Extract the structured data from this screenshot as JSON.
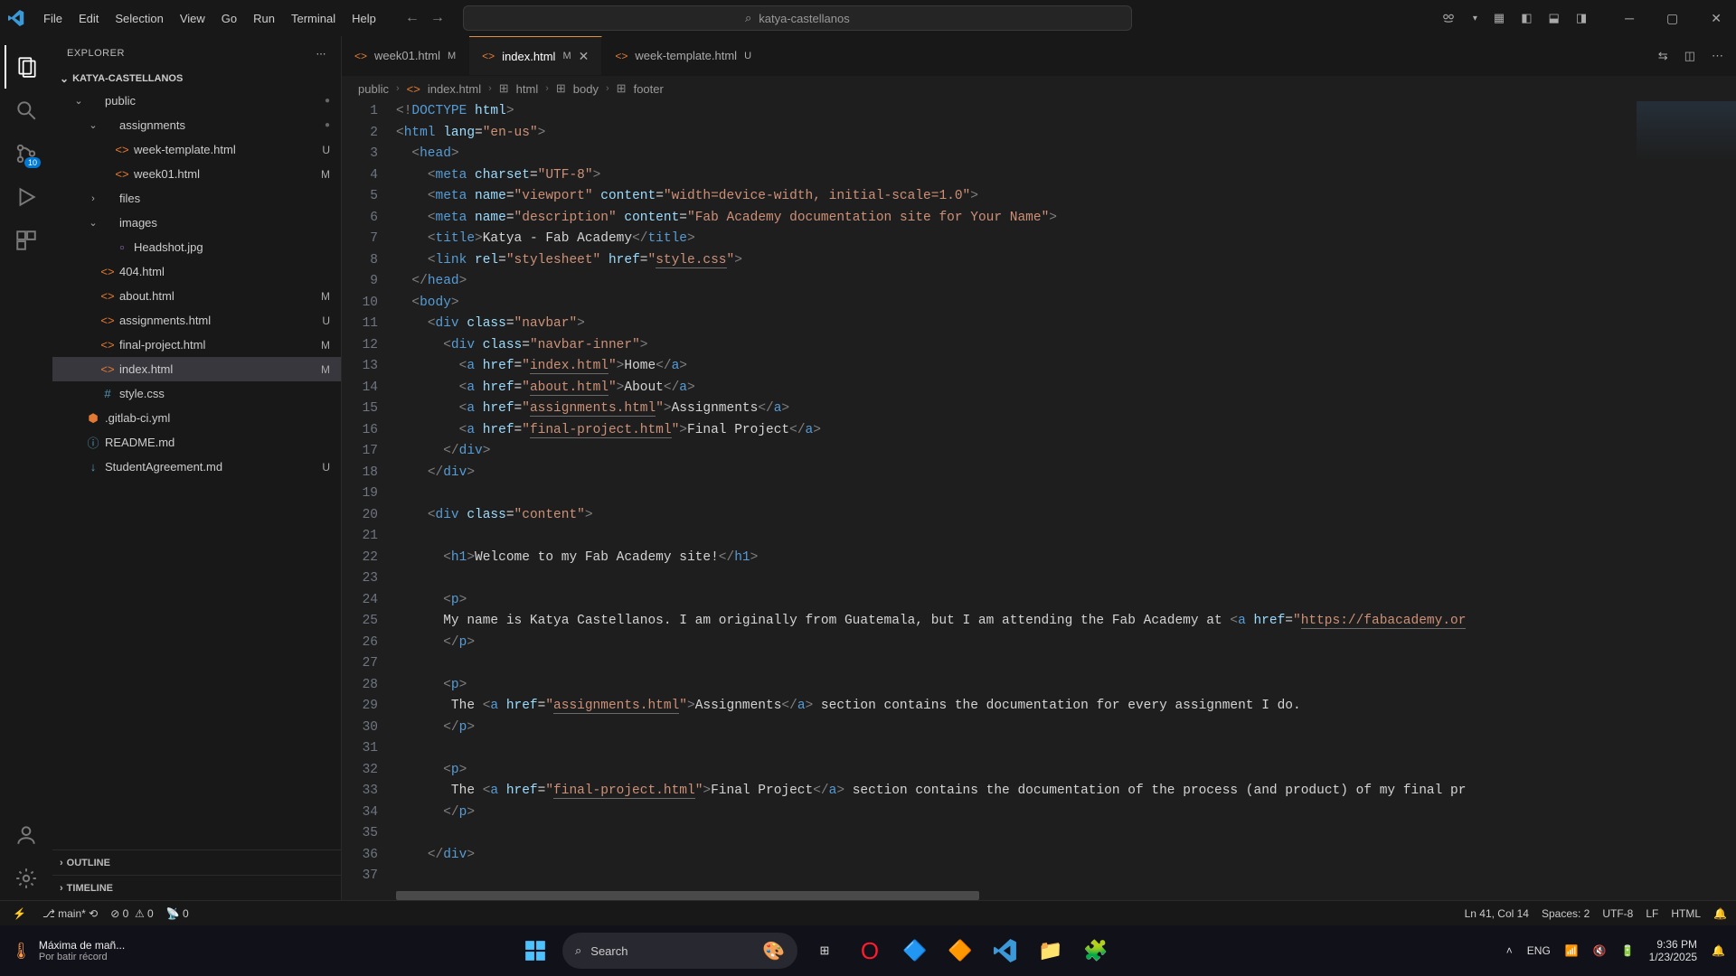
{
  "menu": [
    "File",
    "Edit",
    "Selection",
    "View",
    "Go",
    "Run",
    "Terminal",
    "Help"
  ],
  "search_placeholder": "katya-castellanos",
  "explorer_label": "EXPLORER",
  "project_name": "KATYA-CASTELLANOS",
  "tree": [
    {
      "d": 1,
      "type": "fo",
      "label": "public",
      "dot": true
    },
    {
      "d": 2,
      "type": "fo",
      "label": "assignments",
      "dot": true
    },
    {
      "d": 3,
      "type": "f",
      "icon": "<>",
      "ic": "ic-orange",
      "label": "week-template.html",
      "badge": "U"
    },
    {
      "d": 3,
      "type": "f",
      "icon": "<>",
      "ic": "ic-orange",
      "label": "week01.html",
      "badge": "M"
    },
    {
      "d": 2,
      "type": "fc",
      "label": "files"
    },
    {
      "d": 2,
      "type": "fo",
      "label": "images"
    },
    {
      "d": 3,
      "type": "f",
      "icon": "▫",
      "ic": "ic-purple",
      "label": "Headshot.jpg"
    },
    {
      "d": 2,
      "type": "f",
      "icon": "<>",
      "ic": "ic-orange",
      "label": "404.html"
    },
    {
      "d": 2,
      "type": "f",
      "icon": "<>",
      "ic": "ic-orange",
      "label": "about.html",
      "badge": "M"
    },
    {
      "d": 2,
      "type": "f",
      "icon": "<>",
      "ic": "ic-orange",
      "label": "assignments.html",
      "badge": "U"
    },
    {
      "d": 2,
      "type": "f",
      "icon": "<>",
      "ic": "ic-orange",
      "label": "final-project.html",
      "badge": "M"
    },
    {
      "d": 2,
      "type": "f",
      "icon": "<>",
      "ic": "ic-orange",
      "label": "index.html",
      "badge": "M",
      "sel": true
    },
    {
      "d": 2,
      "type": "f",
      "icon": "#",
      "ic": "ic-blue",
      "label": "style.css"
    },
    {
      "d": 1,
      "type": "f",
      "icon": "⬢",
      "ic": "ic-orange",
      "label": ".gitlab-ci.yml"
    },
    {
      "d": 1,
      "type": "f",
      "icon": "ⓘ",
      "ic": "ic-blue",
      "label": "README.md"
    },
    {
      "d": 1,
      "type": "f",
      "icon": "↓",
      "ic": "ic-blue",
      "label": "StudentAgreement.md",
      "badge": "U"
    }
  ],
  "outline_label": "OUTLINE",
  "timeline_label": "TIMELINE",
  "tabs": [
    {
      "icon": "<>",
      "label": "week01.html",
      "mod": "M",
      "active": false
    },
    {
      "icon": "<>",
      "label": "index.html",
      "mod": "M",
      "active": true,
      "close": true
    },
    {
      "icon": "<>",
      "label": "week-template.html",
      "mod": "U",
      "active": false
    }
  ],
  "breadcrumb": [
    "public",
    "index.html",
    "html",
    "body",
    "footer"
  ],
  "code_lines": [
    [
      {
        "c": "t-gray",
        "t": "<!"
      },
      {
        "c": "t-blue",
        "t": "DOCTYPE"
      },
      {
        "c": "t-txt",
        "t": " "
      },
      {
        "c": "t-lblue",
        "t": "html"
      },
      {
        "c": "t-gray",
        "t": ">"
      }
    ],
    [
      {
        "c": "t-gray",
        "t": "<"
      },
      {
        "c": "t-blue",
        "t": "html"
      },
      {
        "c": "t-txt",
        "t": " "
      },
      {
        "c": "t-lblue",
        "t": "lang"
      },
      {
        "c": "t-txt",
        "t": "="
      },
      {
        "c": "t-str",
        "t": "\"en-us\""
      },
      {
        "c": "t-gray",
        "t": ">"
      }
    ],
    [
      {
        "c": "t-txt",
        "t": "  "
      },
      {
        "c": "t-gray",
        "t": "<"
      },
      {
        "c": "t-blue",
        "t": "head"
      },
      {
        "c": "t-gray",
        "t": ">"
      }
    ],
    [
      {
        "c": "t-txt",
        "t": "    "
      },
      {
        "c": "t-gray",
        "t": "<"
      },
      {
        "c": "t-blue",
        "t": "meta"
      },
      {
        "c": "t-txt",
        "t": " "
      },
      {
        "c": "t-lblue",
        "t": "charset"
      },
      {
        "c": "t-txt",
        "t": "="
      },
      {
        "c": "t-str",
        "t": "\"UTF-8\""
      },
      {
        "c": "t-gray",
        "t": ">"
      }
    ],
    [
      {
        "c": "t-txt",
        "t": "    "
      },
      {
        "c": "t-gray",
        "t": "<"
      },
      {
        "c": "t-blue",
        "t": "meta"
      },
      {
        "c": "t-txt",
        "t": " "
      },
      {
        "c": "t-lblue",
        "t": "name"
      },
      {
        "c": "t-txt",
        "t": "="
      },
      {
        "c": "t-str",
        "t": "\"viewport\""
      },
      {
        "c": "t-txt",
        "t": " "
      },
      {
        "c": "t-lblue",
        "t": "content"
      },
      {
        "c": "t-txt",
        "t": "="
      },
      {
        "c": "t-str",
        "t": "\"width=device-width, initial-scale=1.0\""
      },
      {
        "c": "t-gray",
        "t": ">"
      }
    ],
    [
      {
        "c": "t-txt",
        "t": "    "
      },
      {
        "c": "t-gray",
        "t": "<"
      },
      {
        "c": "t-blue",
        "t": "meta"
      },
      {
        "c": "t-txt",
        "t": " "
      },
      {
        "c": "t-lblue",
        "t": "name"
      },
      {
        "c": "t-txt",
        "t": "="
      },
      {
        "c": "t-str",
        "t": "\"description\""
      },
      {
        "c": "t-txt",
        "t": " "
      },
      {
        "c": "t-lblue",
        "t": "content"
      },
      {
        "c": "t-txt",
        "t": "="
      },
      {
        "c": "t-str",
        "t": "\"Fab Academy documentation site for Your Name\""
      },
      {
        "c": "t-gray",
        "t": ">"
      }
    ],
    [
      {
        "c": "t-txt",
        "t": "    "
      },
      {
        "c": "t-gray",
        "t": "<"
      },
      {
        "c": "t-blue",
        "t": "title"
      },
      {
        "c": "t-gray",
        "t": ">"
      },
      {
        "c": "t-txt",
        "t": "Katya - Fab Academy"
      },
      {
        "c": "t-gray",
        "t": "</"
      },
      {
        "c": "t-blue",
        "t": "title"
      },
      {
        "c": "t-gray",
        "t": ">"
      }
    ],
    [
      {
        "c": "t-txt",
        "t": "    "
      },
      {
        "c": "t-gray",
        "t": "<"
      },
      {
        "c": "t-blue",
        "t": "link"
      },
      {
        "c": "t-txt",
        "t": " "
      },
      {
        "c": "t-lblue",
        "t": "rel"
      },
      {
        "c": "t-txt",
        "t": "="
      },
      {
        "c": "t-str",
        "t": "\"stylesheet\""
      },
      {
        "c": "t-txt",
        "t": " "
      },
      {
        "c": "t-lblue",
        "t": "href"
      },
      {
        "c": "t-txt",
        "t": "="
      },
      {
        "c": "t-str",
        "t": "\""
      },
      {
        "c": "t-burl",
        "t": "style.css"
      },
      {
        "c": "t-str",
        "t": "\""
      },
      {
        "c": "t-gray",
        "t": ">"
      }
    ],
    [
      {
        "c": "t-txt",
        "t": "  "
      },
      {
        "c": "t-gray",
        "t": "</"
      },
      {
        "c": "t-blue",
        "t": "head"
      },
      {
        "c": "t-gray",
        "t": ">"
      }
    ],
    [
      {
        "c": "t-txt",
        "t": "  "
      },
      {
        "c": "t-gray",
        "t": "<"
      },
      {
        "c": "t-blue",
        "t": "body"
      },
      {
        "c": "t-gray",
        "t": ">"
      }
    ],
    [
      {
        "c": "t-txt",
        "t": "    "
      },
      {
        "c": "t-gray",
        "t": "<"
      },
      {
        "c": "t-blue",
        "t": "div"
      },
      {
        "c": "t-txt",
        "t": " "
      },
      {
        "c": "t-lblue",
        "t": "class"
      },
      {
        "c": "t-txt",
        "t": "="
      },
      {
        "c": "t-str",
        "t": "\"navbar\""
      },
      {
        "c": "t-gray",
        "t": ">"
      }
    ],
    [
      {
        "c": "t-txt",
        "t": "      "
      },
      {
        "c": "t-gray",
        "t": "<"
      },
      {
        "c": "t-blue",
        "t": "div"
      },
      {
        "c": "t-txt",
        "t": " "
      },
      {
        "c": "t-lblue",
        "t": "class"
      },
      {
        "c": "t-txt",
        "t": "="
      },
      {
        "c": "t-str",
        "t": "\"navbar-inner\""
      },
      {
        "c": "t-gray",
        "t": ">"
      }
    ],
    [
      {
        "c": "t-txt",
        "t": "        "
      },
      {
        "c": "t-gray",
        "t": "<"
      },
      {
        "c": "t-blue",
        "t": "a"
      },
      {
        "c": "t-txt",
        "t": " "
      },
      {
        "c": "t-lblue",
        "t": "href"
      },
      {
        "c": "t-txt",
        "t": "="
      },
      {
        "c": "t-str",
        "t": "\""
      },
      {
        "c": "t-burl",
        "t": "index.html"
      },
      {
        "c": "t-str",
        "t": "\""
      },
      {
        "c": "t-gray",
        "t": ">"
      },
      {
        "c": "t-txt",
        "t": "Home"
      },
      {
        "c": "t-gray",
        "t": "</"
      },
      {
        "c": "t-blue",
        "t": "a"
      },
      {
        "c": "t-gray",
        "t": ">"
      }
    ],
    [
      {
        "c": "t-txt",
        "t": "        "
      },
      {
        "c": "t-gray",
        "t": "<"
      },
      {
        "c": "t-blue",
        "t": "a"
      },
      {
        "c": "t-txt",
        "t": " "
      },
      {
        "c": "t-lblue",
        "t": "href"
      },
      {
        "c": "t-txt",
        "t": "="
      },
      {
        "c": "t-str",
        "t": "\""
      },
      {
        "c": "t-burl",
        "t": "about.html"
      },
      {
        "c": "t-str",
        "t": "\""
      },
      {
        "c": "t-gray",
        "t": ">"
      },
      {
        "c": "t-txt",
        "t": "About"
      },
      {
        "c": "t-gray",
        "t": "</"
      },
      {
        "c": "t-blue",
        "t": "a"
      },
      {
        "c": "t-gray",
        "t": ">"
      }
    ],
    [
      {
        "c": "t-txt",
        "t": "        "
      },
      {
        "c": "t-gray",
        "t": "<"
      },
      {
        "c": "t-blue",
        "t": "a"
      },
      {
        "c": "t-txt",
        "t": " "
      },
      {
        "c": "t-lblue",
        "t": "href"
      },
      {
        "c": "t-txt",
        "t": "="
      },
      {
        "c": "t-str",
        "t": "\""
      },
      {
        "c": "t-burl",
        "t": "assignments.html"
      },
      {
        "c": "t-str",
        "t": "\""
      },
      {
        "c": "t-gray",
        "t": ">"
      },
      {
        "c": "t-txt",
        "t": "Assignments"
      },
      {
        "c": "t-gray",
        "t": "</"
      },
      {
        "c": "t-blue",
        "t": "a"
      },
      {
        "c": "t-gray",
        "t": ">"
      }
    ],
    [
      {
        "c": "t-txt",
        "t": "        "
      },
      {
        "c": "t-gray",
        "t": "<"
      },
      {
        "c": "t-blue",
        "t": "a"
      },
      {
        "c": "t-txt",
        "t": " "
      },
      {
        "c": "t-lblue",
        "t": "href"
      },
      {
        "c": "t-txt",
        "t": "="
      },
      {
        "c": "t-str",
        "t": "\""
      },
      {
        "c": "t-burl",
        "t": "final-project.html"
      },
      {
        "c": "t-str",
        "t": "\""
      },
      {
        "c": "t-gray",
        "t": ">"
      },
      {
        "c": "t-txt",
        "t": "Final Project"
      },
      {
        "c": "t-gray",
        "t": "</"
      },
      {
        "c": "t-blue",
        "t": "a"
      },
      {
        "c": "t-gray",
        "t": ">"
      }
    ],
    [
      {
        "c": "t-txt",
        "t": "      "
      },
      {
        "c": "t-gray",
        "t": "</"
      },
      {
        "c": "t-blue",
        "t": "div"
      },
      {
        "c": "t-gray",
        "t": ">"
      }
    ],
    [
      {
        "c": "t-txt",
        "t": "    "
      },
      {
        "c": "t-gray",
        "t": "</"
      },
      {
        "c": "t-blue",
        "t": "div"
      },
      {
        "c": "t-gray",
        "t": ">"
      }
    ],
    [],
    [
      {
        "c": "t-txt",
        "t": "    "
      },
      {
        "c": "t-gray",
        "t": "<"
      },
      {
        "c": "t-blue",
        "t": "div"
      },
      {
        "c": "t-txt",
        "t": " "
      },
      {
        "c": "t-lblue",
        "t": "class"
      },
      {
        "c": "t-txt",
        "t": "="
      },
      {
        "c": "t-str",
        "t": "\"content\""
      },
      {
        "c": "t-gray",
        "t": ">"
      }
    ],
    [],
    [
      {
        "c": "t-txt",
        "t": "      "
      },
      {
        "c": "t-gray",
        "t": "<"
      },
      {
        "c": "t-blue",
        "t": "h1"
      },
      {
        "c": "t-gray",
        "t": ">"
      },
      {
        "c": "t-txt",
        "t": "Welcome to my Fab Academy site!"
      },
      {
        "c": "t-gray",
        "t": "</"
      },
      {
        "c": "t-blue",
        "t": "h1"
      },
      {
        "c": "t-gray",
        "t": ">"
      }
    ],
    [],
    [
      {
        "c": "t-txt",
        "t": "      "
      },
      {
        "c": "t-gray",
        "t": "<"
      },
      {
        "c": "t-blue",
        "t": "p"
      },
      {
        "c": "t-gray",
        "t": ">"
      }
    ],
    [
      {
        "c": "t-txt",
        "t": "      My name is Katya Castellanos. I am originally from Guatemala, but I am attending the Fab Academy at "
      },
      {
        "c": "t-gray",
        "t": "<"
      },
      {
        "c": "t-blue",
        "t": "a"
      },
      {
        "c": "t-txt",
        "t": " "
      },
      {
        "c": "t-lblue",
        "t": "href"
      },
      {
        "c": "t-txt",
        "t": "="
      },
      {
        "c": "t-str",
        "t": "\""
      },
      {
        "c": "t-burl",
        "t": "https://fabacademy.or"
      }
    ],
    [
      {
        "c": "t-txt",
        "t": "      "
      },
      {
        "c": "t-gray",
        "t": "</"
      },
      {
        "c": "t-blue",
        "t": "p"
      },
      {
        "c": "t-gray",
        "t": ">"
      }
    ],
    [],
    [
      {
        "c": "t-txt",
        "t": "      "
      },
      {
        "c": "t-gray",
        "t": "<"
      },
      {
        "c": "t-blue",
        "t": "p"
      },
      {
        "c": "t-gray",
        "t": ">"
      }
    ],
    [
      {
        "c": "t-txt",
        "t": "       The "
      },
      {
        "c": "t-gray",
        "t": "<"
      },
      {
        "c": "t-blue",
        "t": "a"
      },
      {
        "c": "t-txt",
        "t": " "
      },
      {
        "c": "t-lblue",
        "t": "href"
      },
      {
        "c": "t-txt",
        "t": "="
      },
      {
        "c": "t-str",
        "t": "\""
      },
      {
        "c": "t-burl",
        "t": "assignments.html"
      },
      {
        "c": "t-str",
        "t": "\""
      },
      {
        "c": "t-gray",
        "t": ">"
      },
      {
        "c": "t-txt",
        "t": "Assignments"
      },
      {
        "c": "t-gray",
        "t": "</"
      },
      {
        "c": "t-blue",
        "t": "a"
      },
      {
        "c": "t-gray",
        "t": ">"
      },
      {
        "c": "t-txt",
        "t": " section contains the documentation for every assignment I do."
      }
    ],
    [
      {
        "c": "t-txt",
        "t": "      "
      },
      {
        "c": "t-gray",
        "t": "</"
      },
      {
        "c": "t-blue",
        "t": "p"
      },
      {
        "c": "t-gray",
        "t": ">"
      }
    ],
    [],
    [
      {
        "c": "t-txt",
        "t": "      "
      },
      {
        "c": "t-gray",
        "t": "<"
      },
      {
        "c": "t-blue",
        "t": "p"
      },
      {
        "c": "t-gray",
        "t": ">"
      }
    ],
    [
      {
        "c": "t-txt",
        "t": "       The "
      },
      {
        "c": "t-gray",
        "t": "<"
      },
      {
        "c": "t-blue",
        "t": "a"
      },
      {
        "c": "t-txt",
        "t": " "
      },
      {
        "c": "t-lblue",
        "t": "href"
      },
      {
        "c": "t-txt",
        "t": "="
      },
      {
        "c": "t-str",
        "t": "\""
      },
      {
        "c": "t-burl",
        "t": "final-project.html"
      },
      {
        "c": "t-str",
        "t": "\""
      },
      {
        "c": "t-gray",
        "t": ">"
      },
      {
        "c": "t-txt",
        "t": "Final Project"
      },
      {
        "c": "t-gray",
        "t": "</"
      },
      {
        "c": "t-blue",
        "t": "a"
      },
      {
        "c": "t-gray",
        "t": ">"
      },
      {
        "c": "t-txt",
        "t": " section contains the documentation of the process (and product) of my final pr"
      }
    ],
    [
      {
        "c": "t-txt",
        "t": "      "
      },
      {
        "c": "t-gray",
        "t": "</"
      },
      {
        "c": "t-blue",
        "t": "p"
      },
      {
        "c": "t-gray",
        "t": ">"
      }
    ],
    [],
    [
      {
        "c": "t-txt",
        "t": "    "
      },
      {
        "c": "t-gray",
        "t": "</"
      },
      {
        "c": "t-blue",
        "t": "div"
      },
      {
        "c": "t-gray",
        "t": ">"
      }
    ],
    []
  ],
  "status": {
    "branch": "main*",
    "errors": "0",
    "warnings": "0",
    "ports": "0",
    "cursor": "Ln 41, Col 14",
    "spaces": "Spaces: 2",
    "encoding": "UTF-8",
    "eol": "LF",
    "lang": "HTML"
  },
  "weather": {
    "line1": "Máxima de mañ...",
    "line2": "Por batir récord"
  },
  "taskbar": {
    "search": "Search",
    "lang": "ENG",
    "time": "9:36 PM",
    "date": "1/23/2025"
  },
  "scm_badge": "10"
}
